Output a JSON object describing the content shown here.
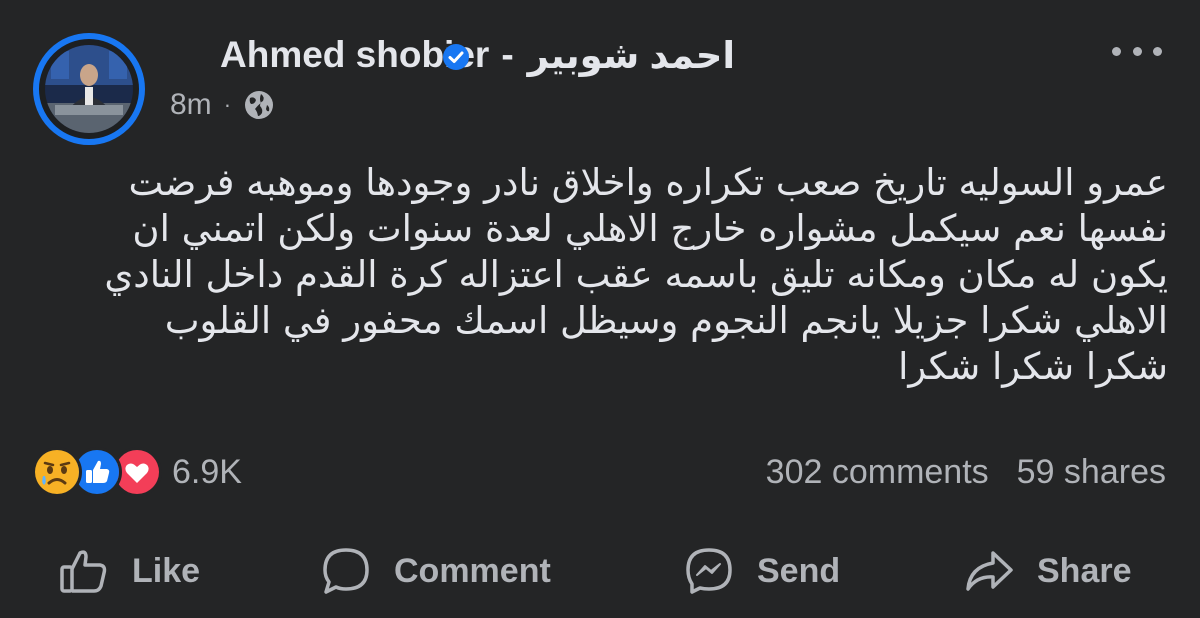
{
  "post": {
    "author_en": "Ahmed shobier",
    "author_sep": "-",
    "author_ar": "احمد شوبير",
    "time": "8m",
    "meta_sep": "·",
    "audience_icon": "globe-icon",
    "more_icon": "more-horizontal-icon",
    "verified_icon": "verified-badge-icon",
    "text_lines": [
      "عمرو السوليه تاريخ صعب تكراره واخلاق نادر وجودها وموهبه فرضت",
      "نفسها نعم سيكمل مشواره خارج الاهلي لعدة سنوات ولكن اتمني ان",
      "يكون له مكان ومكانه تليق باسمه عقب اعتزاله كرة القدم  داخل النادي",
      "الاهلي شكرا جزيلا يانجم النجوم  وسيظل اسمك محفور في القلوب",
      "شكرا شكرا شكرا"
    ]
  },
  "reactions": {
    "icons": [
      "sad-reaction-icon",
      "like-reaction-icon",
      "love-reaction-icon"
    ],
    "count": "6.9K"
  },
  "stats": {
    "comments": "302 comments",
    "shares": "59 shares"
  },
  "actions": {
    "like": "Like",
    "comment": "Comment",
    "send": "Send",
    "share": "Share"
  },
  "colors": {
    "background": "#242526",
    "text_primary": "#e4e6eb",
    "text_secondary": "#b0b3b8",
    "accent_blue": "#1877f2",
    "love_red": "#f33e58",
    "sad_yellow": "#f7b125"
  }
}
